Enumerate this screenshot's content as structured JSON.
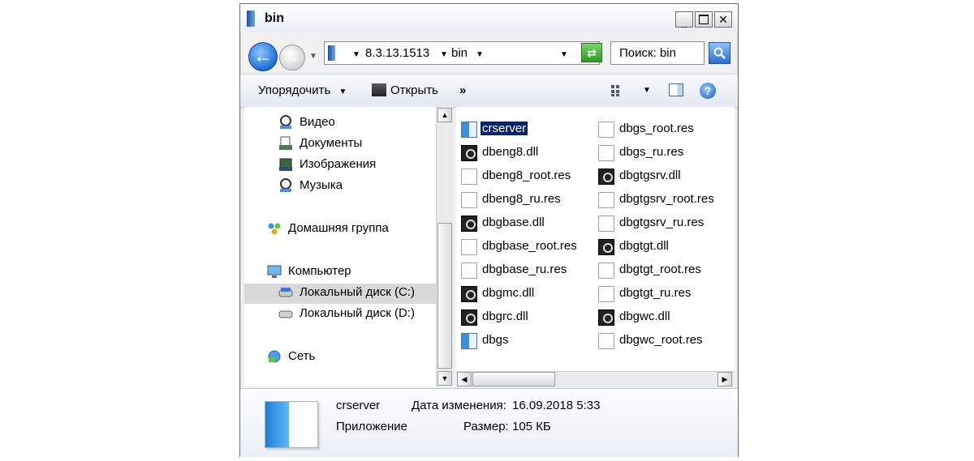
{
  "window": {
    "title": "bin"
  },
  "address": {
    "crumbs": [
      "8.3.13.1513",
      "bin"
    ],
    "search_placeholder": "Поиск: bin"
  },
  "toolbar": {
    "organize": "Упорядочить",
    "open": "Открыть",
    "more": "»"
  },
  "navpane": {
    "items": [
      {
        "label": "Видео",
        "icon": "video-library-icon"
      },
      {
        "label": "Документы",
        "icon": "documents-library-icon"
      },
      {
        "label": "Изображения",
        "icon": "pictures-library-icon"
      },
      {
        "label": "Музыка",
        "icon": "music-library-icon"
      },
      {
        "label": "Домашняя группа",
        "icon": "homegroup-icon"
      },
      {
        "label": "Компьютер",
        "icon": "computer-icon"
      },
      {
        "label": "Локальный диск (C:)",
        "icon": "system-drive-icon",
        "selected": true
      },
      {
        "label": "Локальный диск (D:)",
        "icon": "drive-icon"
      },
      {
        "label": "Сеть",
        "icon": "network-icon"
      }
    ]
  },
  "files": {
    "col1": [
      {
        "name": "crserver",
        "type": "exe",
        "selected": true
      },
      {
        "name": "dbeng8.dll",
        "type": "dll"
      },
      {
        "name": "dbeng8_root.res",
        "type": "res"
      },
      {
        "name": "dbeng8_ru.res",
        "type": "res"
      },
      {
        "name": "dbgbase.dll",
        "type": "dll"
      },
      {
        "name": "dbgbase_root.res",
        "type": "res"
      },
      {
        "name": "dbgbase_ru.res",
        "type": "res"
      },
      {
        "name": "dbgmc.dll",
        "type": "dll"
      },
      {
        "name": "dbgrc.dll",
        "type": "dll"
      },
      {
        "name": "dbgs",
        "type": "exe"
      }
    ],
    "col2": [
      {
        "name": "dbgs_root.res",
        "type": "res"
      },
      {
        "name": "dbgs_ru.res",
        "type": "res"
      },
      {
        "name": "dbgtgsrv.dll",
        "type": "dll"
      },
      {
        "name": "dbgtgsrv_root.res",
        "type": "res"
      },
      {
        "name": "dbgtgsrv_ru.res",
        "type": "res"
      },
      {
        "name": "dbgtgt.dll",
        "type": "dll"
      },
      {
        "name": "dbgtgt_root.res",
        "type": "res"
      },
      {
        "name": "dbgtgt_ru.res",
        "type": "res"
      },
      {
        "name": "dbgwc.dll",
        "type": "dll"
      },
      {
        "name": "dbgwc_root.res",
        "type": "res"
      }
    ]
  },
  "details": {
    "name": "crserver",
    "type": "Приложение",
    "modified_label": "Дата изменения:",
    "modified_value": "16.09.2018 5:33",
    "size_label": "Размер:",
    "size_value": "105 КБ"
  }
}
